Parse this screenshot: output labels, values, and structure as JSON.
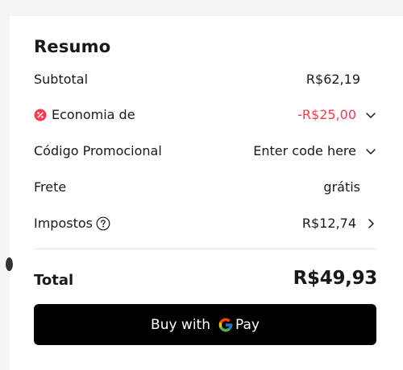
{
  "summary": {
    "title": "Resumo",
    "subtotal": {
      "label": "Subtotal",
      "value": "R$62,19"
    },
    "savings": {
      "label": "Economia de",
      "value": "-R$25,00",
      "color": "#fd384f"
    },
    "promo": {
      "label": "Código Promocional",
      "value": "Enter code here"
    },
    "shipping": {
      "label": "Frete",
      "value": "grátis"
    },
    "taxes": {
      "label": "Impostos",
      "value": "R$12,74"
    },
    "total": {
      "label": "Total",
      "value": "R$49,93"
    },
    "pay_button": {
      "label": "Buy with",
      "brand": "Pay"
    }
  },
  "icons": {
    "savings": "coin-discount-icon",
    "help": "question-circle-icon",
    "expand": "chevron-down-icon",
    "navigate": "chevron-right-icon",
    "google": "google-g-icon"
  }
}
